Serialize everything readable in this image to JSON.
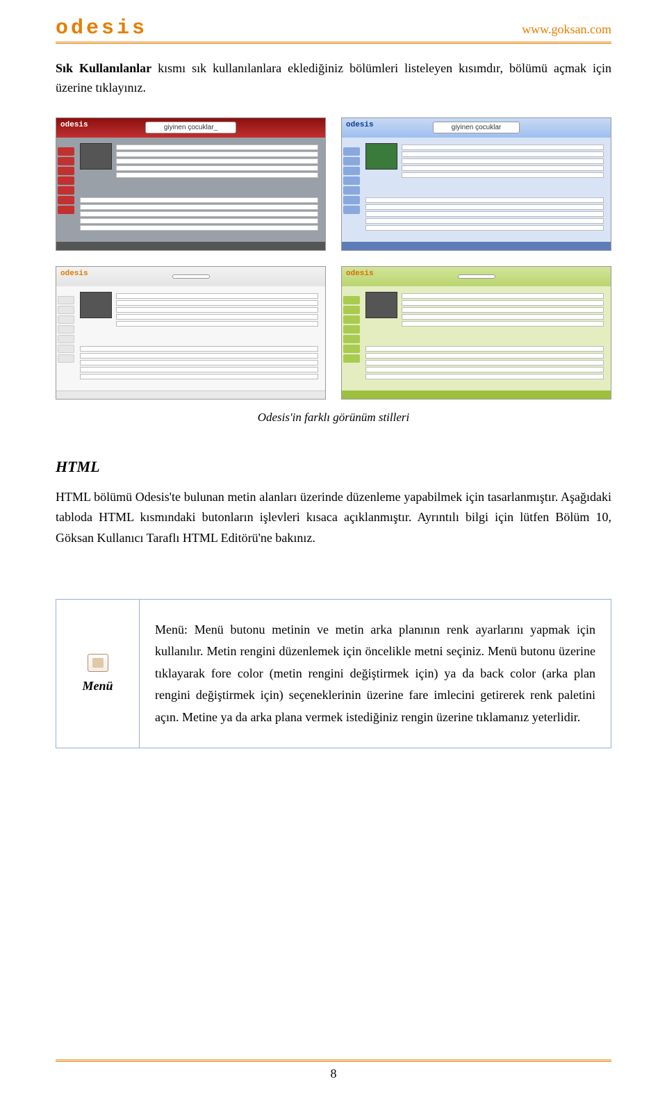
{
  "header": {
    "brand": "odesis",
    "url": "www.goksan.com"
  },
  "intro": {
    "bold_lead": "Sık Kullanılanlar",
    "rest": " kısmı sık kullanılanlara eklediğiniz bölümleri listeleyen kısımdır, bölümü açmak için üzerine tıklayınız."
  },
  "shots": {
    "title1": "giyinen çocuklar_",
    "title2": "giyinen çocuklar",
    "title3": "",
    "title4": "",
    "logo": "odesis"
  },
  "screens_caption": "Odesis'in farklı görünüm stilleri",
  "section": {
    "title": "HTML",
    "paragraph": "HTML bölümü Odesis'te bulunan metin alanları üzerinde düzenleme yapabilmek için tasarlanmıştır. Aşağıdaki tabloda HTML kısmındaki butonların işlevleri kısaca açıklanmıştır. Ayrıntılı bilgi için lütfen Bölüm 10, Göksan Kullanıcı Taraflı HTML Editörü'ne bakınız."
  },
  "table": {
    "row_label": "Menü",
    "row_desc": "Menü: Menü butonu metinin ve metin arka planının renk ayarlarını yapmak için kullanılır. Metin rengini düzenlemek için öncelikle metni seçiniz. Menü butonu üzerine tıklayarak fore color (metin rengini değiştirmek için) ya da back color (arka plan rengini değiştirmek için) seçeneklerinin üzerine fare imlecini getirerek renk paletini açın. Metine ya da arka plana vermek istediğiniz rengin üzerine tıklamanız yeterlidir."
  },
  "page_number": "8"
}
